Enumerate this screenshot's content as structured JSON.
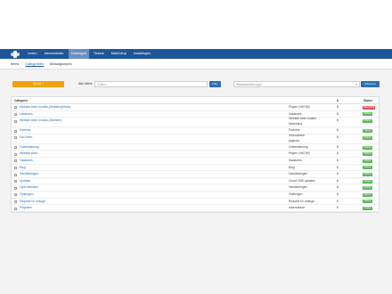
{
  "nav": {
    "items": [
      {
        "label": "Leden"
      },
      {
        "label": "Administratie"
      },
      {
        "label": "Catalogue"
      },
      {
        "label": "Tickets"
      },
      {
        "label": "Mailchimp"
      },
      {
        "label": "Installingen"
      }
    ],
    "active_index": 2
  },
  "subnav": {
    "items": [
      {
        "label": "Items"
      },
      {
        "label": "Categorieën"
      },
      {
        "label": "Betaalgroepen"
      }
    ],
    "active_index": 1
  },
  "toolbar": {
    "new_label": "Nieuw +",
    "filter_label": "Alle filters",
    "filter_placeholder": "Zoeken",
    "filter_button": "Filter",
    "type_placeholder": "Standaard item type",
    "type_button": "Uitvoeren"
  },
  "table": {
    "headers": {
      "name": "Categorie",
      "currency": "$",
      "status": "Status"
    },
    "rows": [
      {
        "name": "Website-been moduls-(Website)(Mods)",
        "type": "Prijzen (%KOM)",
        "currency": "$",
        "status": "Niet actief",
        "status_color": "#d9534f"
      },
      {
        "name": "Vacatures",
        "type": "Vacatures",
        "currency": "$",
        "status": "Online",
        "status_color": "#5cb85c"
      },
      {
        "name": "Website-been moduls-(Website)",
        "type": "Website-been maken",
        "sub": "Nederland",
        "currency": "$",
        "status": "Online",
        "status_color": "#5cb85c"
      },
      {
        "name": "Partners",
        "type": "Partners",
        "currency": "$",
        "status": "Online",
        "status_color": "#5cb85c"
      },
      {
        "name": "Doc-been",
        "type": "Informatieve",
        "sub": "pagina's",
        "currency": "$",
        "status": "Online",
        "status_color": "#5cb85c"
      },
      {
        "name": "Ondersteuning",
        "type": "Ondersteuning",
        "currency": "$",
        "status": "Online",
        "status_color": "#5cb85c"
      },
      {
        "name": "Website-been",
        "type": "Prijzen (%KOM)",
        "currency": "$",
        "status": "Online",
        "status_color": "#5cb85c"
      },
      {
        "name": "Vacatures",
        "type": "Vacatures",
        "currency": "$",
        "status": "Online",
        "status_color": "#5cb85c"
      },
      {
        "name": "Blog",
        "type": "Blog",
        "currency": "$",
        "status": "Online",
        "status_color": "#5cb85c"
      },
      {
        "name": "Handleidingen",
        "type": "Handleidingen",
        "currency": "$",
        "status": "Online",
        "status_color": "#5cb85c"
      },
      {
        "name": "Updates",
        "type": "Cloud CMS updates",
        "currency": "$",
        "status": "Online",
        "status_color": "#5cb85c"
      },
      {
        "name": "Type websites",
        "type": "Handleidingen",
        "currency": "$",
        "status": "Online",
        "status_color": "#5cb85c"
      },
      {
        "name": "Trainingen",
        "type": "Trainingen",
        "currency": "$",
        "status": "Online",
        "status_color": "#5cb85c"
      },
      {
        "name": "Request for change",
        "type": "Request for change",
        "currency": "$",
        "status": "Online",
        "status_color": "#5cb85c"
      },
      {
        "name": "Projecten",
        "type": "Informatieve",
        "currency": "$",
        "status": "Online",
        "status_color": "#5cb85c"
      }
    ]
  },
  "colors": {
    "nav": "#1e5799",
    "accent": "#f0a30a",
    "primary": "#2a6fb6",
    "online": "#5cb85c",
    "inactive": "#d9534f"
  }
}
